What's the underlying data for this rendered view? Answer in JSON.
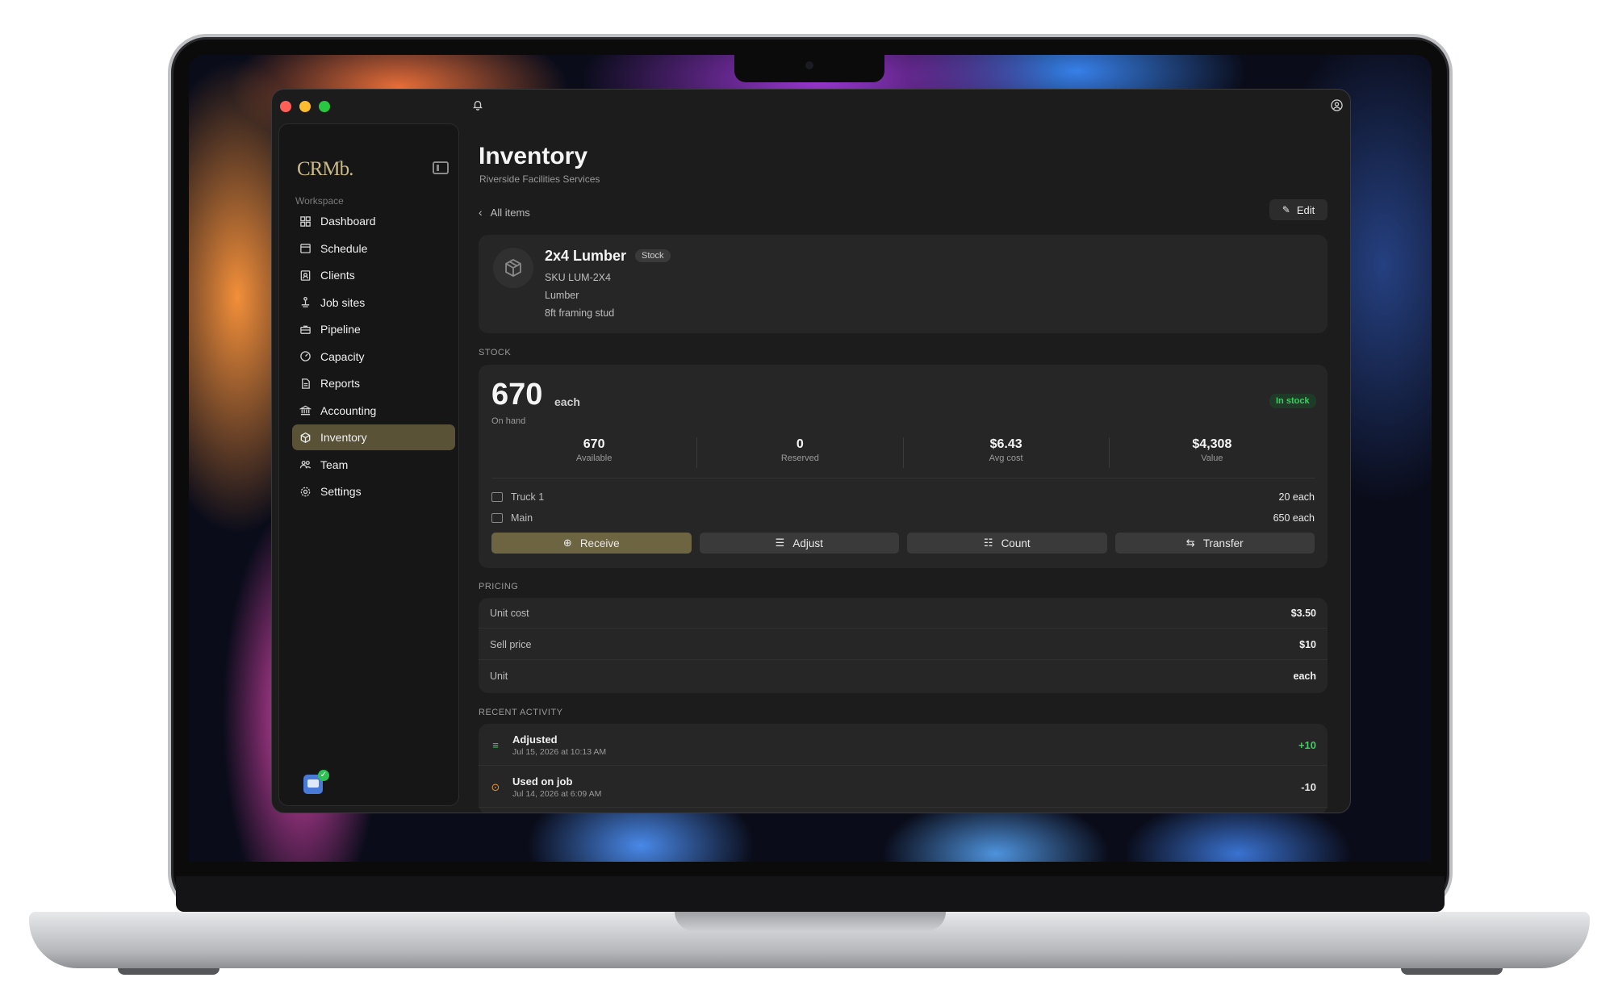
{
  "app": {
    "logo_text": "CRMb.",
    "workspace_label": "Workspace"
  },
  "sidebar": {
    "items": [
      {
        "label": "Dashboard",
        "icon": "grid-icon",
        "active": false
      },
      {
        "label": "Schedule",
        "icon": "calendar-icon",
        "active": false
      },
      {
        "label": "Clients",
        "icon": "contacts-icon",
        "active": false
      },
      {
        "label": "Job sites",
        "icon": "anchor-pin-icon",
        "active": false
      },
      {
        "label": "Pipeline",
        "icon": "briefcase-icon",
        "active": false
      },
      {
        "label": "Capacity",
        "icon": "gauge-icon",
        "active": false
      },
      {
        "label": "Reports",
        "icon": "document-icon",
        "active": false
      },
      {
        "label": "Accounting",
        "icon": "bank-icon",
        "active": false
      },
      {
        "label": "Inventory",
        "icon": "box-icon",
        "active": true
      },
      {
        "label": "Team",
        "icon": "people-icon",
        "active": false
      },
      {
        "label": "Settings",
        "icon": "gear-icon",
        "active": false
      }
    ]
  },
  "header": {
    "title": "Inventory",
    "subtitle": "Riverside Facilities Services",
    "back_label": "All items",
    "edit_label": "Edit"
  },
  "item": {
    "name": "2x4 Lumber",
    "badge": "Stock",
    "sku": "SKU LUM-2X4",
    "category": "Lumber",
    "description": "8ft framing stud"
  },
  "stock": {
    "section_label": "STOCK",
    "on_hand": "670",
    "unit": "each",
    "on_hand_label": "On hand",
    "status": "In stock",
    "metrics": [
      {
        "value": "670",
        "label": "Available"
      },
      {
        "value": "0",
        "label": "Reserved"
      },
      {
        "value": "$6.43",
        "label": "Avg cost"
      },
      {
        "value": "$4,308",
        "label": "Value"
      }
    ],
    "locations": [
      {
        "name": "Truck 1",
        "qty": "20 each"
      },
      {
        "name": "Main",
        "qty": "650 each"
      }
    ],
    "actions": {
      "receive": "Receive",
      "adjust": "Adjust",
      "count": "Count",
      "transfer": "Transfer"
    }
  },
  "pricing": {
    "section_label": "PRICING",
    "rows": [
      {
        "label": "Unit cost",
        "value": "$3.50"
      },
      {
        "label": "Sell price",
        "value": "$10"
      },
      {
        "label": "Unit",
        "value": "each"
      }
    ]
  },
  "activity": {
    "section_label": "RECENT ACTIVITY",
    "rows": [
      {
        "title": "Adjusted",
        "date": "Jul 15, 2026 at 10:13 AM",
        "qty": "+10",
        "color": "#3ccf62"
      },
      {
        "title": "Used on job",
        "date": "Jul 14, 2026 at 6:09 AM",
        "qty": "-10",
        "color": "#e6e6e6"
      }
    ]
  },
  "colors": {
    "accent": "#6d6442",
    "active_nav": "#5a5237",
    "positive": "#3ccf62",
    "warning": "#e8902e"
  }
}
